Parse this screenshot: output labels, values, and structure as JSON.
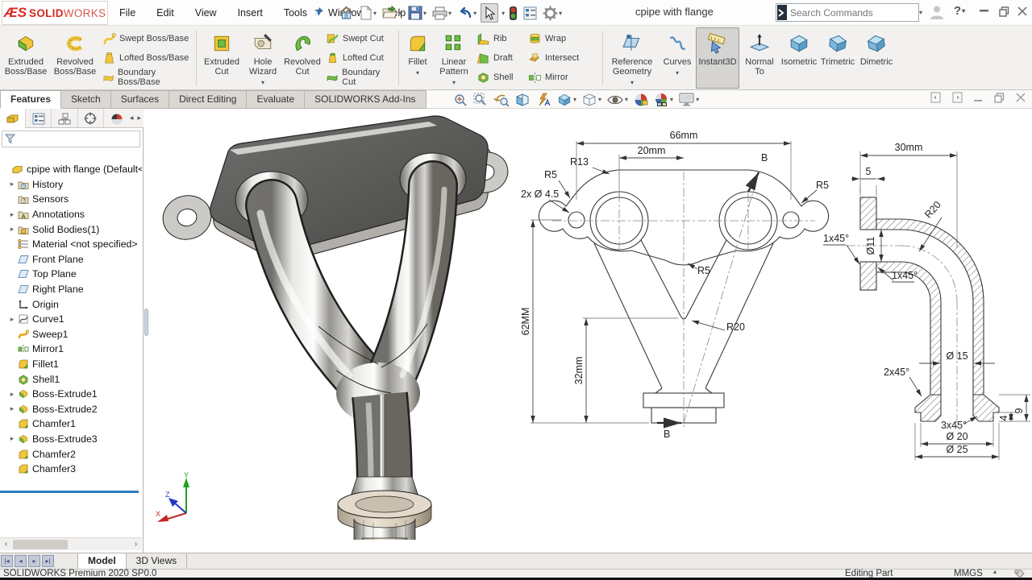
{
  "window": {
    "brand_glyph": "ÆS",
    "brand_bold": "SOLID",
    "brand_light": "WORKS",
    "title": "cpipe with flange",
    "search_placeholder": "Search Commands",
    "help_glyph": "?"
  },
  "menus": [
    "File",
    "Edit",
    "View",
    "Insert",
    "Tools",
    "Window",
    "Help"
  ],
  "qat_icons": [
    "home-icon",
    "new-document-icon",
    "open-icon",
    "save-icon",
    "print-icon",
    "undo-icon",
    "select-cursor-icon",
    "rebuild-traffic-light-icon",
    "options-list-icon",
    "settings-gear-icon"
  ],
  "ribbon": {
    "buttons": [
      "Extruded Boss/Base",
      "Revolved Boss/Base",
      "Swept Boss/Base",
      "Lofted Boss/Base",
      "Boundary Boss/Base",
      "Extruded Cut",
      "Hole Wizard",
      "Revolved Cut",
      "Swept Cut",
      "Lofted Cut",
      "Boundary Cut",
      "Fillet",
      "Linear Pattern",
      "Rib",
      "Draft",
      "Shell",
      "Wrap",
      "Intersect",
      "Mirror",
      "Reference Geometry",
      "Curves",
      "Instant3D",
      "Normal To",
      "Isometric",
      "Trimetric",
      "Dimetric"
    ]
  },
  "maintabs": [
    "Features",
    "Sketch",
    "Surfaces",
    "Direct Editing",
    "Evaluate",
    "SOLIDWORKS Add-Ins"
  ],
  "headsup_icons": [
    "zoom-to-fit-icon",
    "zoom-to-area-icon",
    "previous-view-icon",
    "section-view-icon",
    "dynamic-annotation-icon",
    "view-orientation-icon",
    "display-style-icon",
    "hide-show-items-icon",
    "edit-appearance-icon",
    "apply-scene-icon",
    "view-settings-icon"
  ],
  "tree": {
    "filter_value": "",
    "root": "cpipe with flange (Default<<De",
    "items": [
      "History",
      "Sensors",
      "Annotations",
      "Solid Bodies(1)",
      "Material <not specified>",
      "Front Plane",
      "Top Plane",
      "Right Plane",
      "Origin",
      "Curve1",
      "Sweep1",
      "Mirror1",
      "Fillet1",
      "Shell1",
      "Boss-Extrude1",
      "Boss-Extrude2",
      "Chamfer1",
      "Boss-Extrude3",
      "Chamfer2",
      "Chamfer3"
    ]
  },
  "front_view": {
    "dim66": "66mm",
    "dim20": "20mm",
    "r13": "R13",
    "r5_left": "R5",
    "holes": "2x Ø 4.5",
    "r5_right": "R5",
    "r5_mid": "R5",
    "r20": "R20",
    "dim62": "62MM",
    "dim32": "32mm",
    "section_b_top": "B",
    "section_b_bottom": "B"
  },
  "section_view": {
    "dim30": "30mm",
    "dim5": "5",
    "d11": "Ø11",
    "r20": "R20",
    "ch45_left": "1x45°",
    "ch45_inner": "1x45°",
    "d15": "Ø 15",
    "ch245": "2x45°",
    "ch345": "3x45°",
    "d20": "Ø 20",
    "d25": "Ø 25",
    "dim9": "9",
    "dim4": "4"
  },
  "triad": {
    "x": "X",
    "y": "Y",
    "z": "Z"
  },
  "doctabs": {
    "model": "Model",
    "views3d": "3D Views"
  },
  "status": {
    "product": "SOLIDWORKS Premium 2020 SP0.0",
    "mode": "Editing Part",
    "units": "MMGS"
  },
  "colors": {
    "brand_red": "#d6281e",
    "rollback_blue": "#2f7bc1",
    "icon_yellow": "#f0c63a",
    "icon_green": "#6fbe44",
    "icon_blue": "#7ab3d6"
  }
}
